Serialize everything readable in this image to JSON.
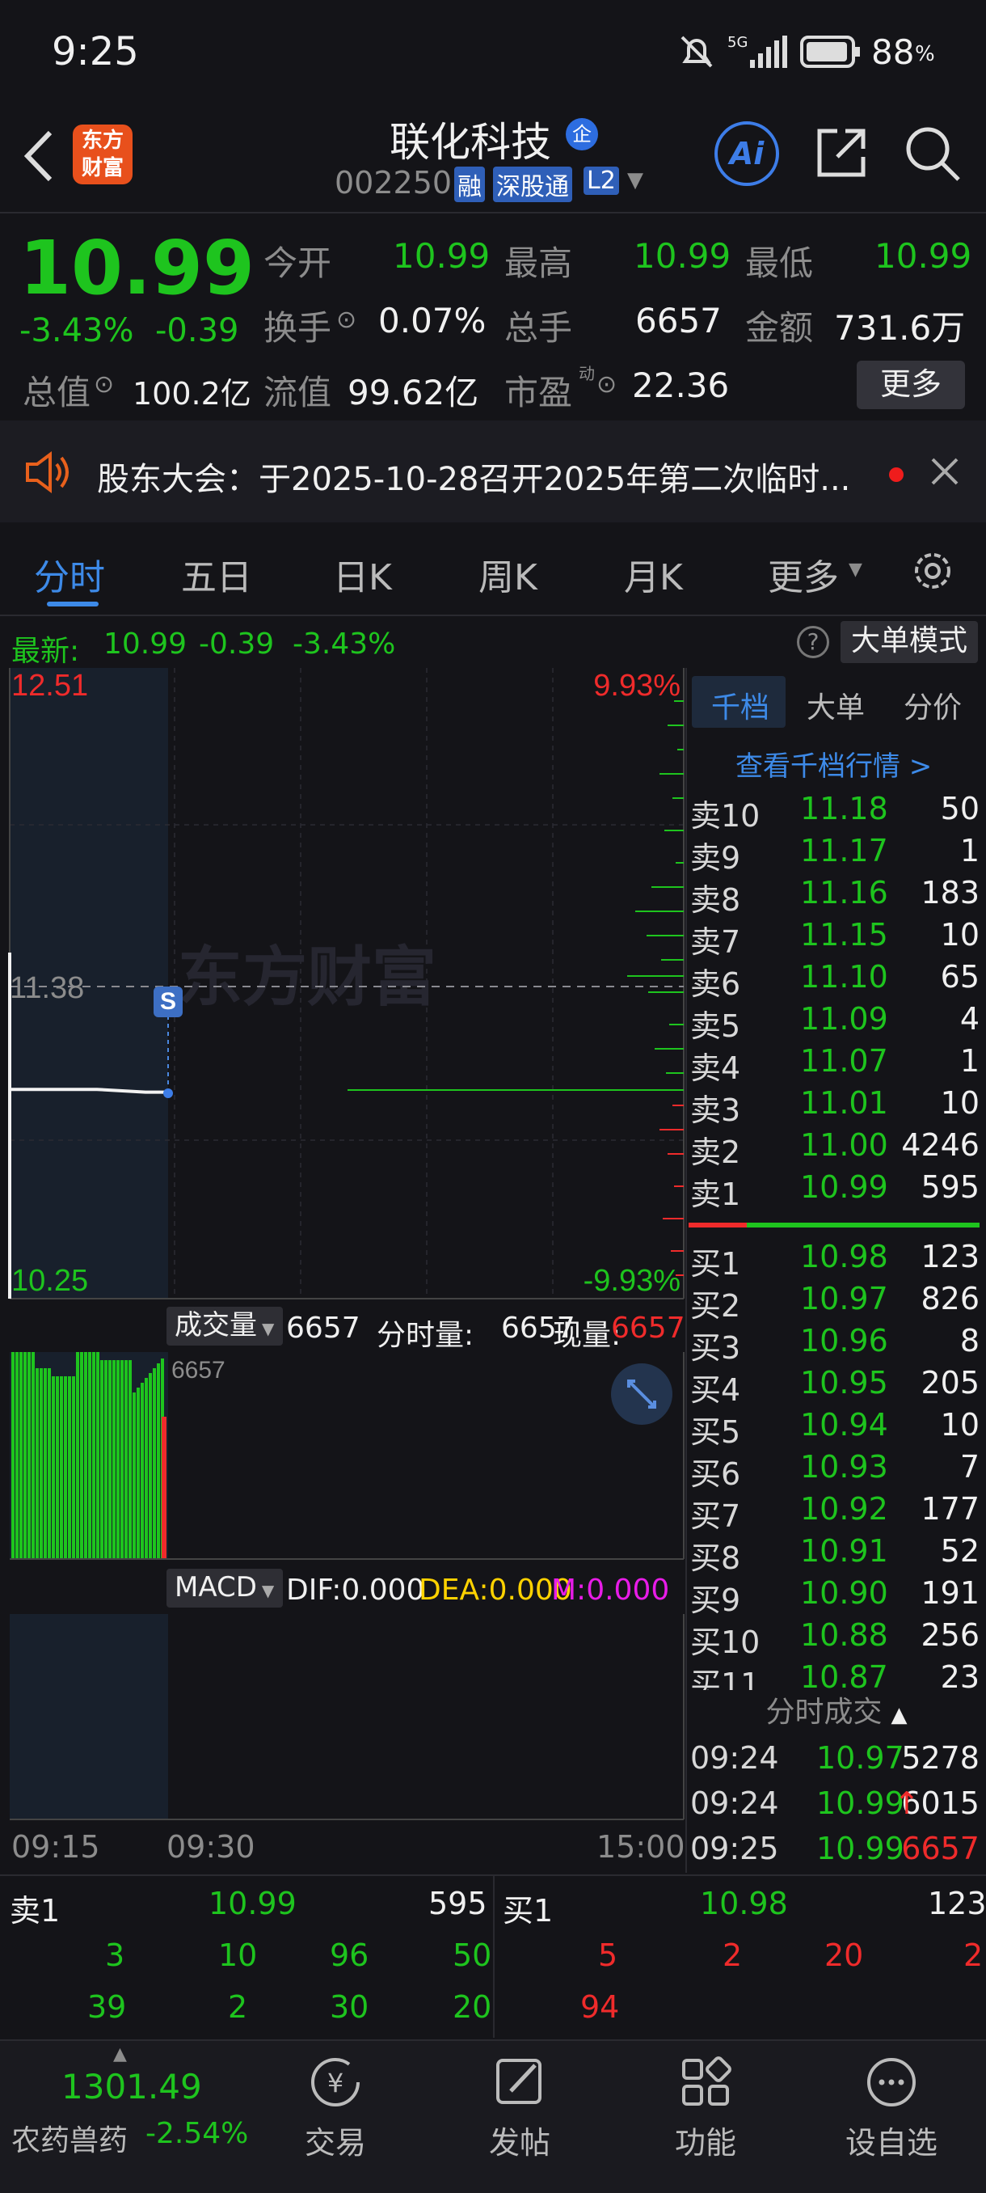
{
  "status": {
    "time": "9:25",
    "battery": "88",
    "battery_unit": "%",
    "signal": "5G"
  },
  "header": {
    "title": "联化科技",
    "badge": "企",
    "code": "002250",
    "tag1": "融",
    "tag2": "深股通",
    "tag3": "L2",
    "logo_top": "东方",
    "logo_bottom": "财富",
    "ai": "Ai"
  },
  "quote": {
    "price": "10.99",
    "change_pct": "-3.43%",
    "change": "-0.39",
    "open_label": "今开",
    "open": "10.99",
    "high_label": "最高",
    "high": "10.99",
    "low_label": "最低",
    "low": "10.99",
    "turnover_label": "换手",
    "turnover": "0.07%",
    "vol_label": "总手",
    "vol": "6657",
    "amount_label": "金额",
    "amount": "731.6万",
    "mktcap_label": "总值",
    "mktcap": "100.2亿",
    "float_label": "流值",
    "float": "99.62亿",
    "pe_label": "市盈",
    "pe_sup": "动",
    "pe": "22.36",
    "more": "更多"
  },
  "notice": {
    "text": "股东大会：于2025-10-28召开2025年第二次临时..."
  },
  "tabs": [
    "分时",
    "五日",
    "日K",
    "周K",
    "月K",
    "更多"
  ],
  "latest": {
    "label": "最新:",
    "price": "10.99",
    "change": "-0.39",
    "pct": "-3.43%",
    "mode": "大单模式"
  },
  "chart": {
    "y_top": "12.51",
    "y_mid": "11.38",
    "y_bot": "10.25",
    "pct_top": "9.93%",
    "pct_bot": "-9.93%",
    "watermark": "东方财富",
    "marker": "S",
    "x_labels": [
      "09:15",
      "09:30",
      "15:00"
    ],
    "volume_label": "成交量",
    "volume_value": "6657",
    "period_label": "分时量:",
    "period_value": "6657",
    "now_label": "现量:",
    "now_value": "6657",
    "vol_max": "6657",
    "macd_label": "MACD",
    "dif": "DIF:0.000",
    "dea": "DEA:0.000",
    "m": "M:0.000"
  },
  "chart_data": {
    "type": "line",
    "x": [
      "09:15",
      "09:20",
      "09:24",
      "09:25"
    ],
    "series": [
      {
        "values": [
          11.0,
          11.0,
          10.99,
          10.99
        ]
      }
    ],
    "ylim": [
      10.25,
      12.51
    ]
  },
  "orderbook": {
    "tabs": [
      "千档",
      "大单",
      "分价"
    ],
    "link": "查看千档行情 >",
    "asks": [
      {
        "label": "卖10",
        "price": "11.18",
        "qty": "50"
      },
      {
        "label": "卖9",
        "price": "11.17",
        "qty": "1"
      },
      {
        "label": "卖8",
        "price": "11.16",
        "qty": "183"
      },
      {
        "label": "卖7",
        "price": "11.15",
        "qty": "10"
      },
      {
        "label": "卖6",
        "price": "11.10",
        "qty": "65"
      },
      {
        "label": "卖5",
        "price": "11.09",
        "qty": "4"
      },
      {
        "label": "卖4",
        "price": "11.07",
        "qty": "1"
      },
      {
        "label": "卖3",
        "price": "11.01",
        "qty": "10"
      },
      {
        "label": "卖2",
        "price": "11.00",
        "qty": "4246"
      },
      {
        "label": "卖1",
        "price": "10.99",
        "qty": "595"
      }
    ],
    "bids": [
      {
        "label": "买1",
        "price": "10.98",
        "qty": "123"
      },
      {
        "label": "买2",
        "price": "10.97",
        "qty": "826"
      },
      {
        "label": "买3",
        "price": "10.96",
        "qty": "8"
      },
      {
        "label": "买4",
        "price": "10.95",
        "qty": "205"
      },
      {
        "label": "买5",
        "price": "10.94",
        "qty": "10"
      },
      {
        "label": "买6",
        "price": "10.93",
        "qty": "7"
      },
      {
        "label": "买7",
        "price": "10.92",
        "qty": "177"
      },
      {
        "label": "买8",
        "price": "10.91",
        "qty": "52"
      },
      {
        "label": "买9",
        "price": "10.90",
        "qty": "191"
      },
      {
        "label": "买10",
        "price": "10.88",
        "qty": "256"
      },
      {
        "label": "买11",
        "price": "10.87",
        "qty": "23"
      }
    ],
    "trades_title": "分时成交",
    "trades": [
      {
        "time": "09:24",
        "price": "10.97",
        "qty": "5278"
      },
      {
        "time": "09:24",
        "price": "10.99",
        "qty": "6015"
      },
      {
        "time": "09:25",
        "price": "10.99",
        "qty": "6657"
      }
    ]
  },
  "queue": {
    "sell_label": "卖1",
    "sell_price": "10.99",
    "sell_qty": "595",
    "buy_label": "买1",
    "buy_price": "10.98",
    "buy_qty": "123",
    "sell_r1": [
      "3",
      "10",
      "96",
      "50"
    ],
    "sell_r2": [
      "39",
      "2",
      "30",
      "20"
    ],
    "buy_r1": [
      "5",
      "2",
      "20",
      "2"
    ],
    "buy_r2": [
      "94"
    ]
  },
  "bottom": {
    "index_value": "1301.49",
    "index_name": "农药兽药",
    "index_pct": "-2.54%",
    "nav": [
      "交易",
      "发帖",
      "功能",
      "设自选"
    ]
  }
}
